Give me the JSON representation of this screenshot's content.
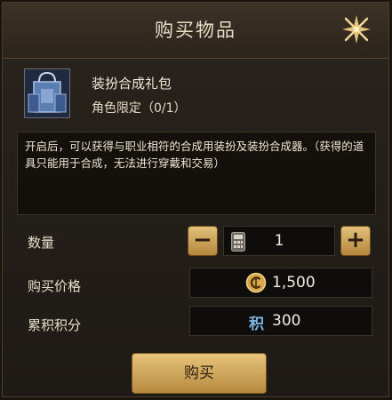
{
  "header": {
    "title": "购买物品"
  },
  "item": {
    "name": "装扮合成礼包",
    "limit": "角色限定（0/1）"
  },
  "description": "开启后，可以获得与职业相符的合成用装扮及装扮合成器。（获得的道具只能用于合成，无法进行穿戴和交易）",
  "quantity": {
    "label": "数量",
    "value": "1",
    "minus_label": "−",
    "plus_label": "+"
  },
  "price": {
    "label": "购买价格",
    "value": "1,500",
    "currency_icon": "gold-coin-icon"
  },
  "points": {
    "label": "累积积分",
    "icon_text": "积",
    "value": "300"
  },
  "buy_button": {
    "label": "购买"
  },
  "colors": {
    "accent_gold": "#d9b163",
    "title_text": "#e9dcc4",
    "points_blue": "#7fb6e8"
  }
}
